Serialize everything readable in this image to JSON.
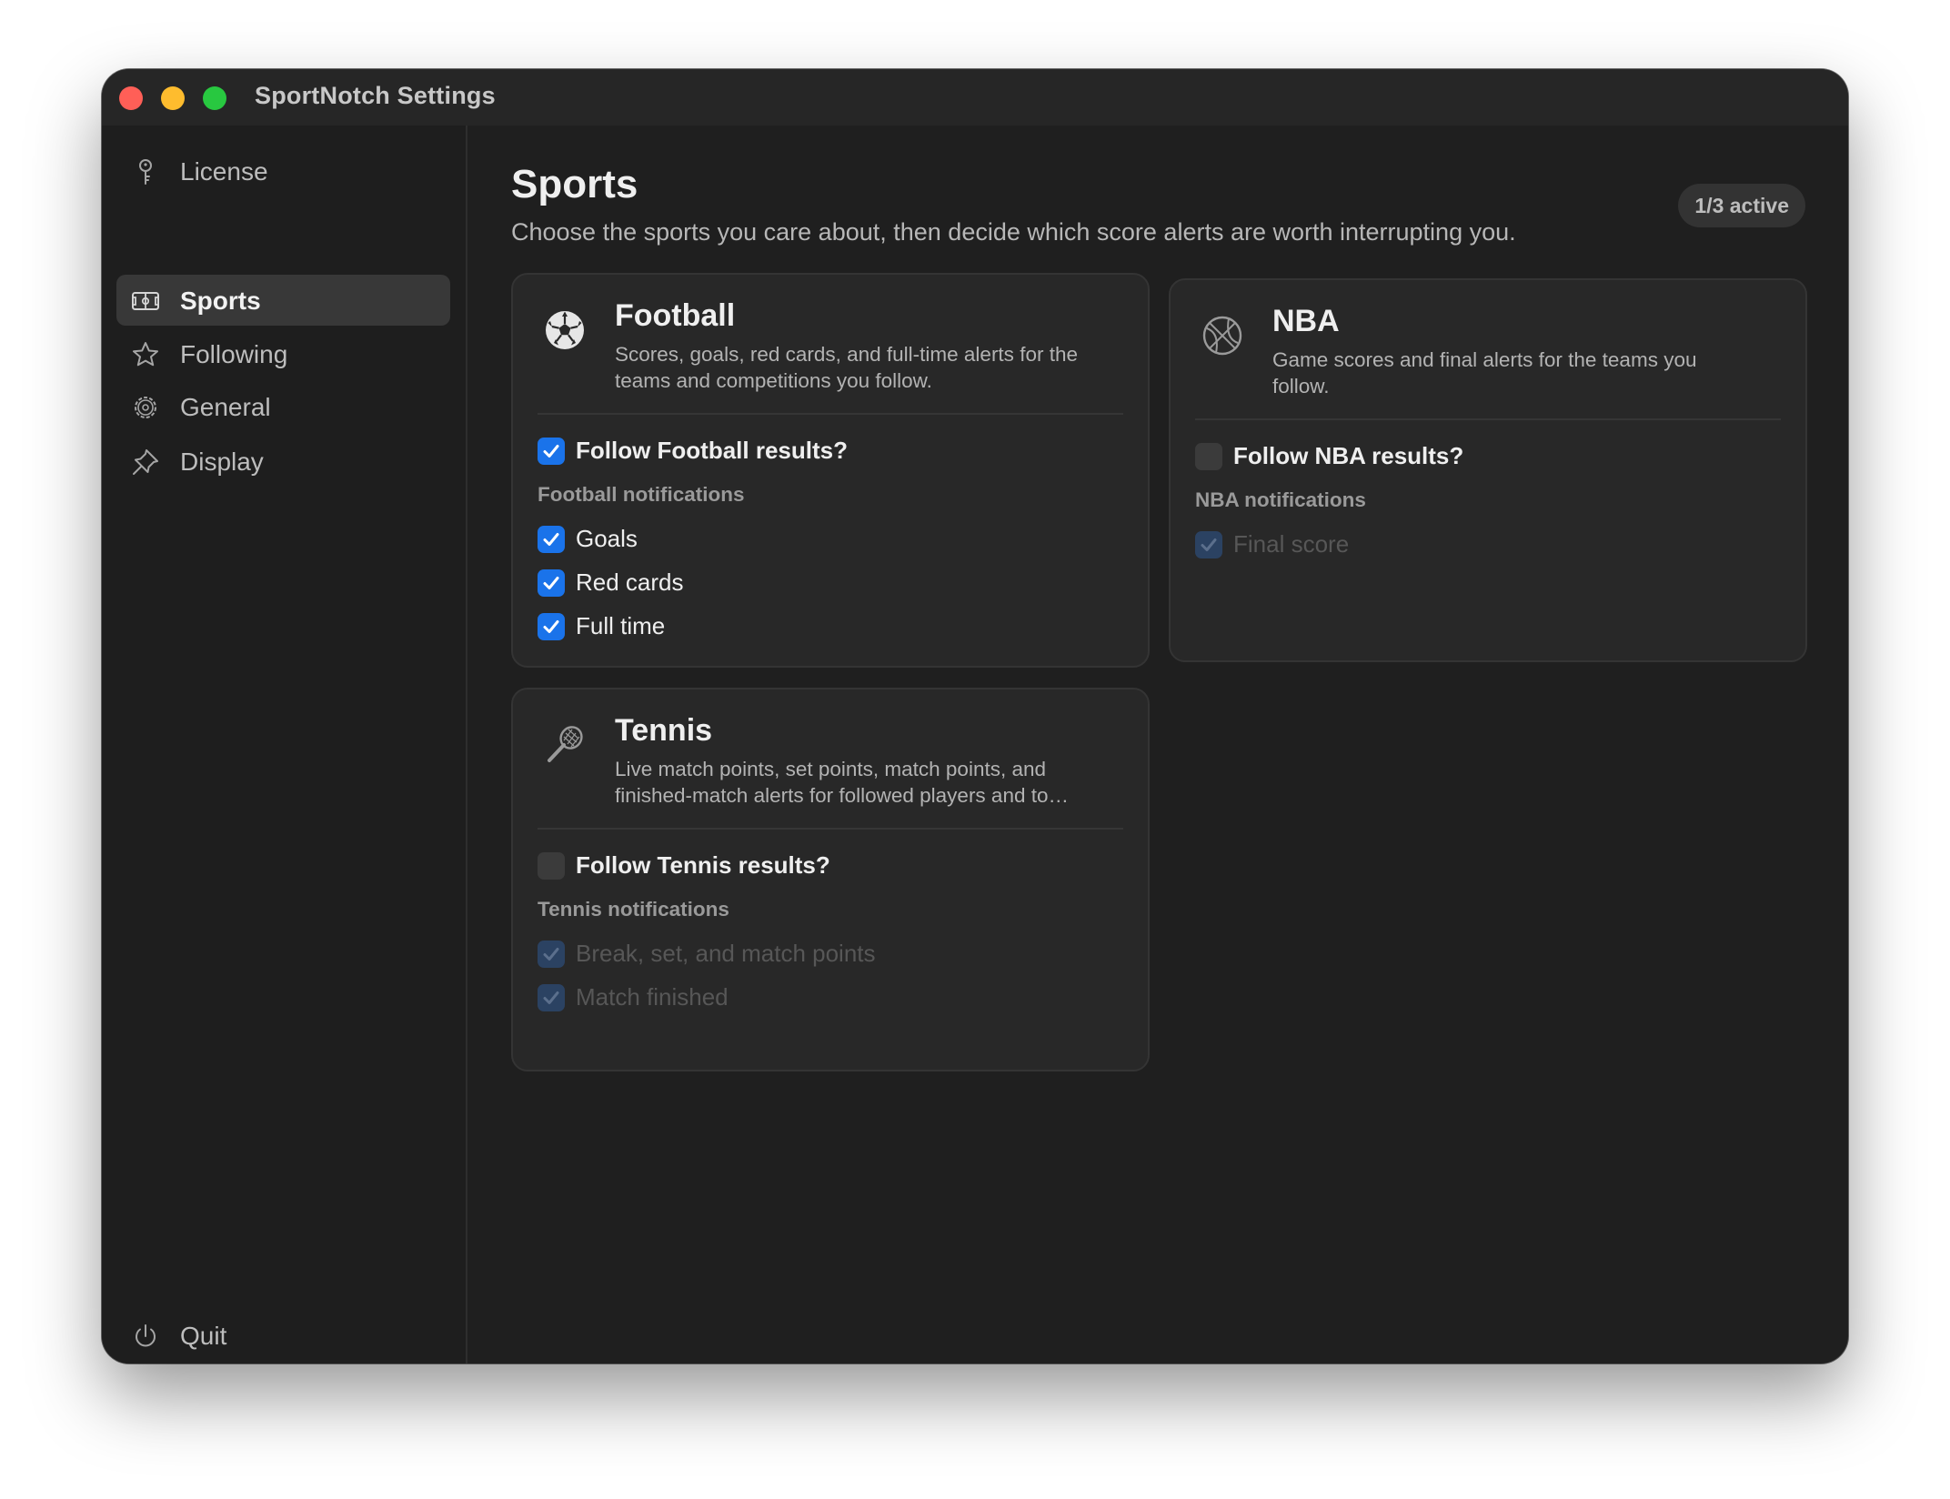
{
  "window": {
    "title": "SportNotch Settings"
  },
  "sidebar": {
    "items": [
      {
        "label": "License",
        "icon": "key-icon",
        "selected": false
      },
      {
        "label": "Sports",
        "icon": "scoreboard-icon",
        "selected": true
      },
      {
        "label": "Following",
        "icon": "star-icon",
        "selected": false
      },
      {
        "label": "General",
        "icon": "gear-icon",
        "selected": false
      },
      {
        "label": "Display",
        "icon": "pin-icon",
        "selected": false
      }
    ],
    "quit": {
      "label": "Quit",
      "icon": "power-icon"
    }
  },
  "main": {
    "title": "Sports",
    "subtitle": "Choose the sports you care about, then decide which score alerts are worth interrupting you.",
    "active_badge": "1/3 active",
    "cards": {
      "football": {
        "title": "Football",
        "icon": "soccer-ball-icon",
        "description": "Scores, goals, red cards, and full-time alerts for the teams and competitions you follow.",
        "follow": {
          "label": "Follow Football results?",
          "checked": true
        },
        "notifications_label": "Football notifications",
        "options": [
          {
            "label": "Goals",
            "checked": true,
            "enabled": true
          },
          {
            "label": "Red cards",
            "checked": true,
            "enabled": true
          },
          {
            "label": "Full time",
            "checked": true,
            "enabled": true
          }
        ]
      },
      "nba": {
        "title": "NBA",
        "icon": "basketball-icon",
        "description": "Game scores and final alerts for the teams you follow.",
        "follow": {
          "label": "Follow NBA results?",
          "checked": false
        },
        "notifications_label": "NBA notifications",
        "options": [
          {
            "label": "Final score",
            "checked": true,
            "enabled": false
          }
        ]
      },
      "tennis": {
        "title": "Tennis",
        "icon": "tennis-racket-icon",
        "description": "Live match points, set points, match points, and finished-match alerts for followed players and to…",
        "follow": {
          "label": "Follow Tennis results?",
          "checked": false
        },
        "notifications_label": "Tennis notifications",
        "options": [
          {
            "label": "Break, set, and match points",
            "checked": true,
            "enabled": false
          },
          {
            "label": "Match finished",
            "checked": true,
            "enabled": false
          }
        ]
      }
    }
  },
  "colors": {
    "accent": "#1a73ea",
    "window_bg": "#1f1f1f",
    "card_bg": "#282828",
    "sidebar_selected": "#383838",
    "traffic_close": "#ff5f57",
    "traffic_minimize": "#febc2e",
    "traffic_zoom": "#28c840"
  }
}
